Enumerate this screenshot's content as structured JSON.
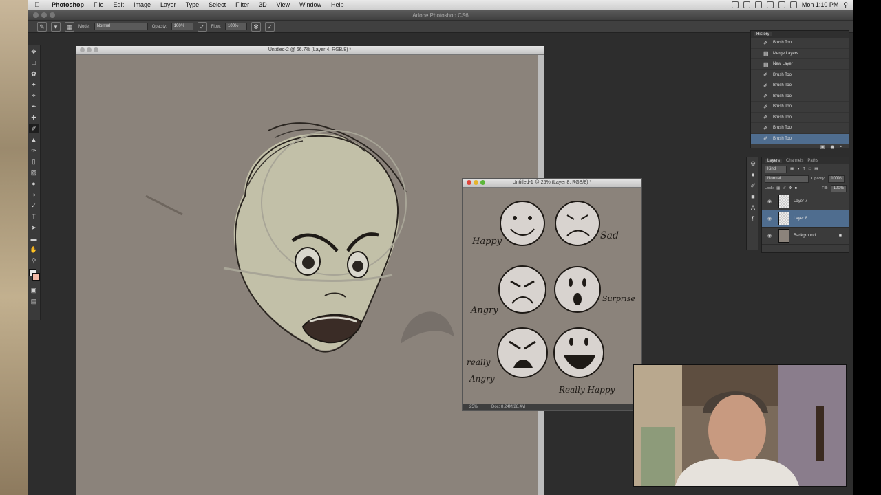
{
  "menubar": {
    "app_name": "Photoshop",
    "items": [
      "File",
      "Edit",
      "Image",
      "Layer",
      "Type",
      "Select",
      "Filter",
      "3D",
      "View",
      "Window",
      "Help"
    ],
    "clock": "Mon 1:10 PM"
  },
  "app": {
    "title": "Adobe Photoshop CS6"
  },
  "options": {
    "mode_label": "Mode:",
    "mode_value": "Normal",
    "opacity_label": "Opacity:",
    "opacity_value": "100%",
    "flow_label": "Flow:",
    "flow_value": "100%"
  },
  "doc1": {
    "title": "Untitled-2 @ 66.7% (Layer 4, RGB/8) *"
  },
  "doc2": {
    "title": "Untitled-1 @ 25% (Layer 8, RGB/8) *",
    "zoom": "25%",
    "doc_size": "Doc: 8.24M/28.4M",
    "labels": {
      "happy": "Happy",
      "sad": "Sad",
      "angry": "Angry",
      "surprise": "Surprise",
      "really_angry_1": "really",
      "really_angry_2": "Angry",
      "really_happy": "Really Happy"
    }
  },
  "history": {
    "tab": "History",
    "items": [
      {
        "label": "Brush Tool",
        "icon": "brush"
      },
      {
        "label": "Merge Layers",
        "icon": "layers"
      },
      {
        "label": "New Layer",
        "icon": "layers"
      },
      {
        "label": "Brush Tool",
        "icon": "brush"
      },
      {
        "label": "Brush Tool",
        "icon": "brush"
      },
      {
        "label": "Brush Tool",
        "icon": "brush"
      },
      {
        "label": "Brush Tool",
        "icon": "brush"
      },
      {
        "label": "Brush Tool",
        "icon": "brush"
      },
      {
        "label": "Brush Tool",
        "icon": "brush"
      },
      {
        "label": "Brush Tool",
        "icon": "brush"
      }
    ],
    "selected_index": 9
  },
  "layers": {
    "tabs": [
      "Layers",
      "Channels",
      "Paths"
    ],
    "kind_label": "Kind",
    "blend": "Normal",
    "opacity_label": "Opacity:",
    "opacity": "100%",
    "lock_label": "Lock:",
    "fill_label": "Fill:",
    "fill": "100%",
    "items": [
      {
        "name": "Layer 7",
        "selected": false
      },
      {
        "name": "Layer 8",
        "selected": true
      },
      {
        "name": "Background",
        "selected": false,
        "locked": true
      }
    ]
  },
  "colors": {
    "canvas": "#8b837b",
    "selection": "#4f6d8f",
    "ui_dark": "#3b3b3b"
  }
}
